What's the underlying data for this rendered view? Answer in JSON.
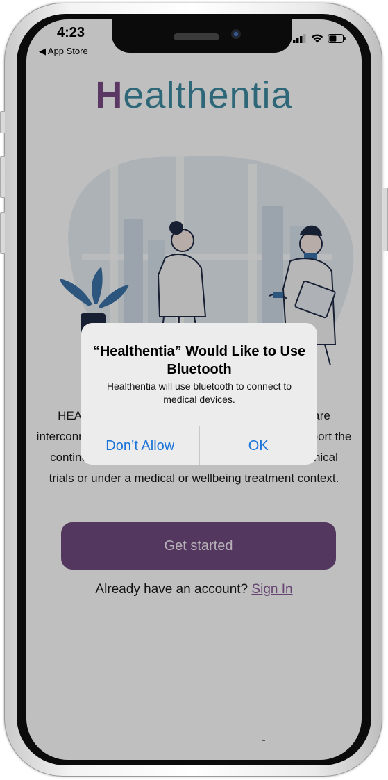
{
  "status_bar": {
    "time": "4:23",
    "back_label": "◀ App Store"
  },
  "app": {
    "logo_text": "ealthentia",
    "logo_initial": "H",
    "description": "HEALTHENTIA is a platform whose components are interconnected to enable healthcare providers to support the continuous remote monitoring of patients during clinical trials or under a medical or wellbeing treatment context.",
    "cta_label": "Get started",
    "signin_prompt": "Already have an account?",
    "signin_link": "Sign In"
  },
  "alert": {
    "title": "“Healthentia” Would Like to Use Bluetooth",
    "message": "Healthentia will use bluetooth to connect to medical devices.",
    "deny_label": "Don’t Allow",
    "ok_label": "OK"
  },
  "colors": {
    "brand_purple": "#714a7e",
    "brand_teal": "#3d8aa0",
    "ios_blue": "#1a73d8"
  },
  "icons": [
    "signal-icon",
    "wifi-icon",
    "battery-icon",
    "back-arrow-icon"
  ]
}
